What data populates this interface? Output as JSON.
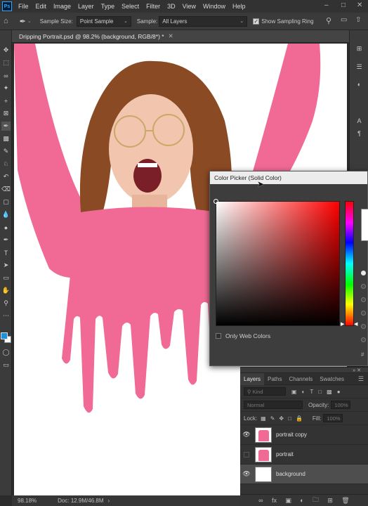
{
  "menu": [
    "File",
    "Edit",
    "Image",
    "Layer",
    "Type",
    "Select",
    "Filter",
    "3D",
    "View",
    "Window",
    "Help"
  ],
  "options_bar": {
    "sample_size_label": "Sample Size:",
    "sample_size_value": "Point Sample",
    "sample_label": "Sample:",
    "sample_value": "All Layers",
    "sampling_ring_label": "Show Sampling Ring"
  },
  "document": {
    "tab_title": "Dripping Portrait.psd @ 98.2% (background, RGB/8*) *",
    "zoom": "98.18%",
    "doc_info": "Doc: 12.9M/46.8M"
  },
  "color_picker": {
    "title": "Color Picker (Solid Color)",
    "only_web_colors": "Only Web Colors"
  },
  "layers_panel": {
    "tabs": [
      "Layers",
      "Paths",
      "Channels",
      "Swatches"
    ],
    "kind_placeholder": "Kind",
    "blend_mode": "Normal",
    "opacity_label": "Opacity:",
    "opacity_value": "100%",
    "lock_label": "Lock:",
    "fill_label": "Fill:",
    "fill_value": "100%",
    "layers": [
      {
        "name": "portrait copy",
        "visible": true
      },
      {
        "name": "portrait",
        "visible": false
      },
      {
        "name": "background",
        "visible": true,
        "selected": true
      }
    ]
  },
  "colors": {
    "sweater_pink": "#f06a95",
    "foreground_swatch": "#1e90d6",
    "background_swatch": "#ffffff"
  }
}
